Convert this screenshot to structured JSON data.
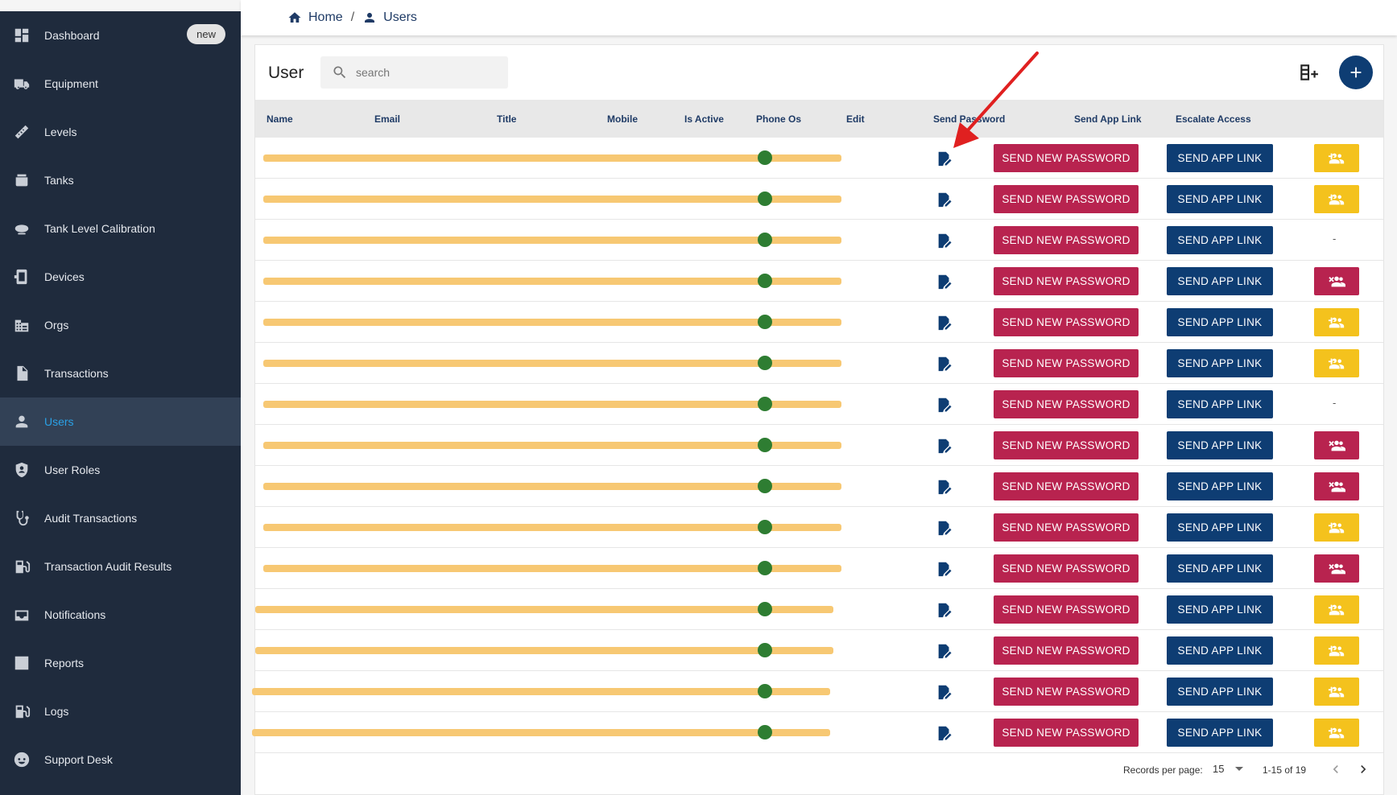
{
  "sidebar": {
    "items": [
      {
        "label": "Dashboard",
        "icon": "dashboard-icon",
        "badge": "new"
      },
      {
        "label": "Equipment",
        "icon": "truck-icon"
      },
      {
        "label": "Levels",
        "icon": "ruler-icon"
      },
      {
        "label": "Tanks",
        "icon": "tank-icon"
      },
      {
        "label": "Tank Level Calibration",
        "icon": "blimp-icon"
      },
      {
        "label": "Devices",
        "icon": "device-icon"
      },
      {
        "label": "Orgs",
        "icon": "building-icon"
      },
      {
        "label": "Transactions",
        "icon": "file-icon"
      },
      {
        "label": "Users",
        "icon": "person-icon",
        "active": true
      },
      {
        "label": "User Roles",
        "icon": "shield-user-icon"
      },
      {
        "label": "Audit Transactions",
        "icon": "stethoscope-icon"
      },
      {
        "label": "Transaction Audit Results",
        "icon": "fuel-icon"
      },
      {
        "label": "Notifications",
        "icon": "inbox-icon"
      },
      {
        "label": "Reports",
        "icon": "bar-chart-icon"
      },
      {
        "label": "Logs",
        "icon": "fuel-pump-icon"
      },
      {
        "label": "Support Desk",
        "icon": "face-icon"
      }
    ]
  },
  "breadcrumb": {
    "home": "Home",
    "separator": "/",
    "current": "Users"
  },
  "card": {
    "title": "User",
    "search_placeholder": "search"
  },
  "table": {
    "columns": [
      "Name",
      "Email",
      "Title",
      "Mobile",
      "Is Active",
      "Phone Os",
      "Edit",
      "Send Password",
      "Send App Link",
      "Escalate Access"
    ],
    "send_password_label": "SEND NEW PASSWORD",
    "send_app_link_label": "SEND APP LINK",
    "rows": [
      {
        "is_active": true,
        "escalate": "up"
      },
      {
        "is_active": true,
        "escalate": "up"
      },
      {
        "is_active": true,
        "escalate": "-"
      },
      {
        "is_active": true,
        "escalate": "down"
      },
      {
        "is_active": true,
        "escalate": "up"
      },
      {
        "is_active": true,
        "escalate": "up"
      },
      {
        "is_active": true,
        "escalate": "-"
      },
      {
        "is_active": true,
        "escalate": "down"
      },
      {
        "is_active": true,
        "escalate": "down"
      },
      {
        "is_active": true,
        "escalate": "up"
      },
      {
        "is_active": true,
        "escalate": "down"
      },
      {
        "is_active": true,
        "escalate": "up"
      },
      {
        "is_active": true,
        "escalate": "up"
      },
      {
        "is_active": true,
        "escalate": "up"
      },
      {
        "is_active": true,
        "escalate": "up"
      }
    ]
  },
  "pagination": {
    "records_per_page_label": "Records per page:",
    "records_per_page": "15",
    "range": "1-15 of 19"
  },
  "colors": {
    "sidebar_bg": "#1f2b3d",
    "sidebar_active_bg": "#324156",
    "active_text": "#2aa1e6",
    "primary": "#0e3d73",
    "danger": "#b8234f",
    "warning": "#f4c21d",
    "success": "#2e7d32",
    "redaction": "#f7c873",
    "annotation_arrow": "#e02020"
  }
}
